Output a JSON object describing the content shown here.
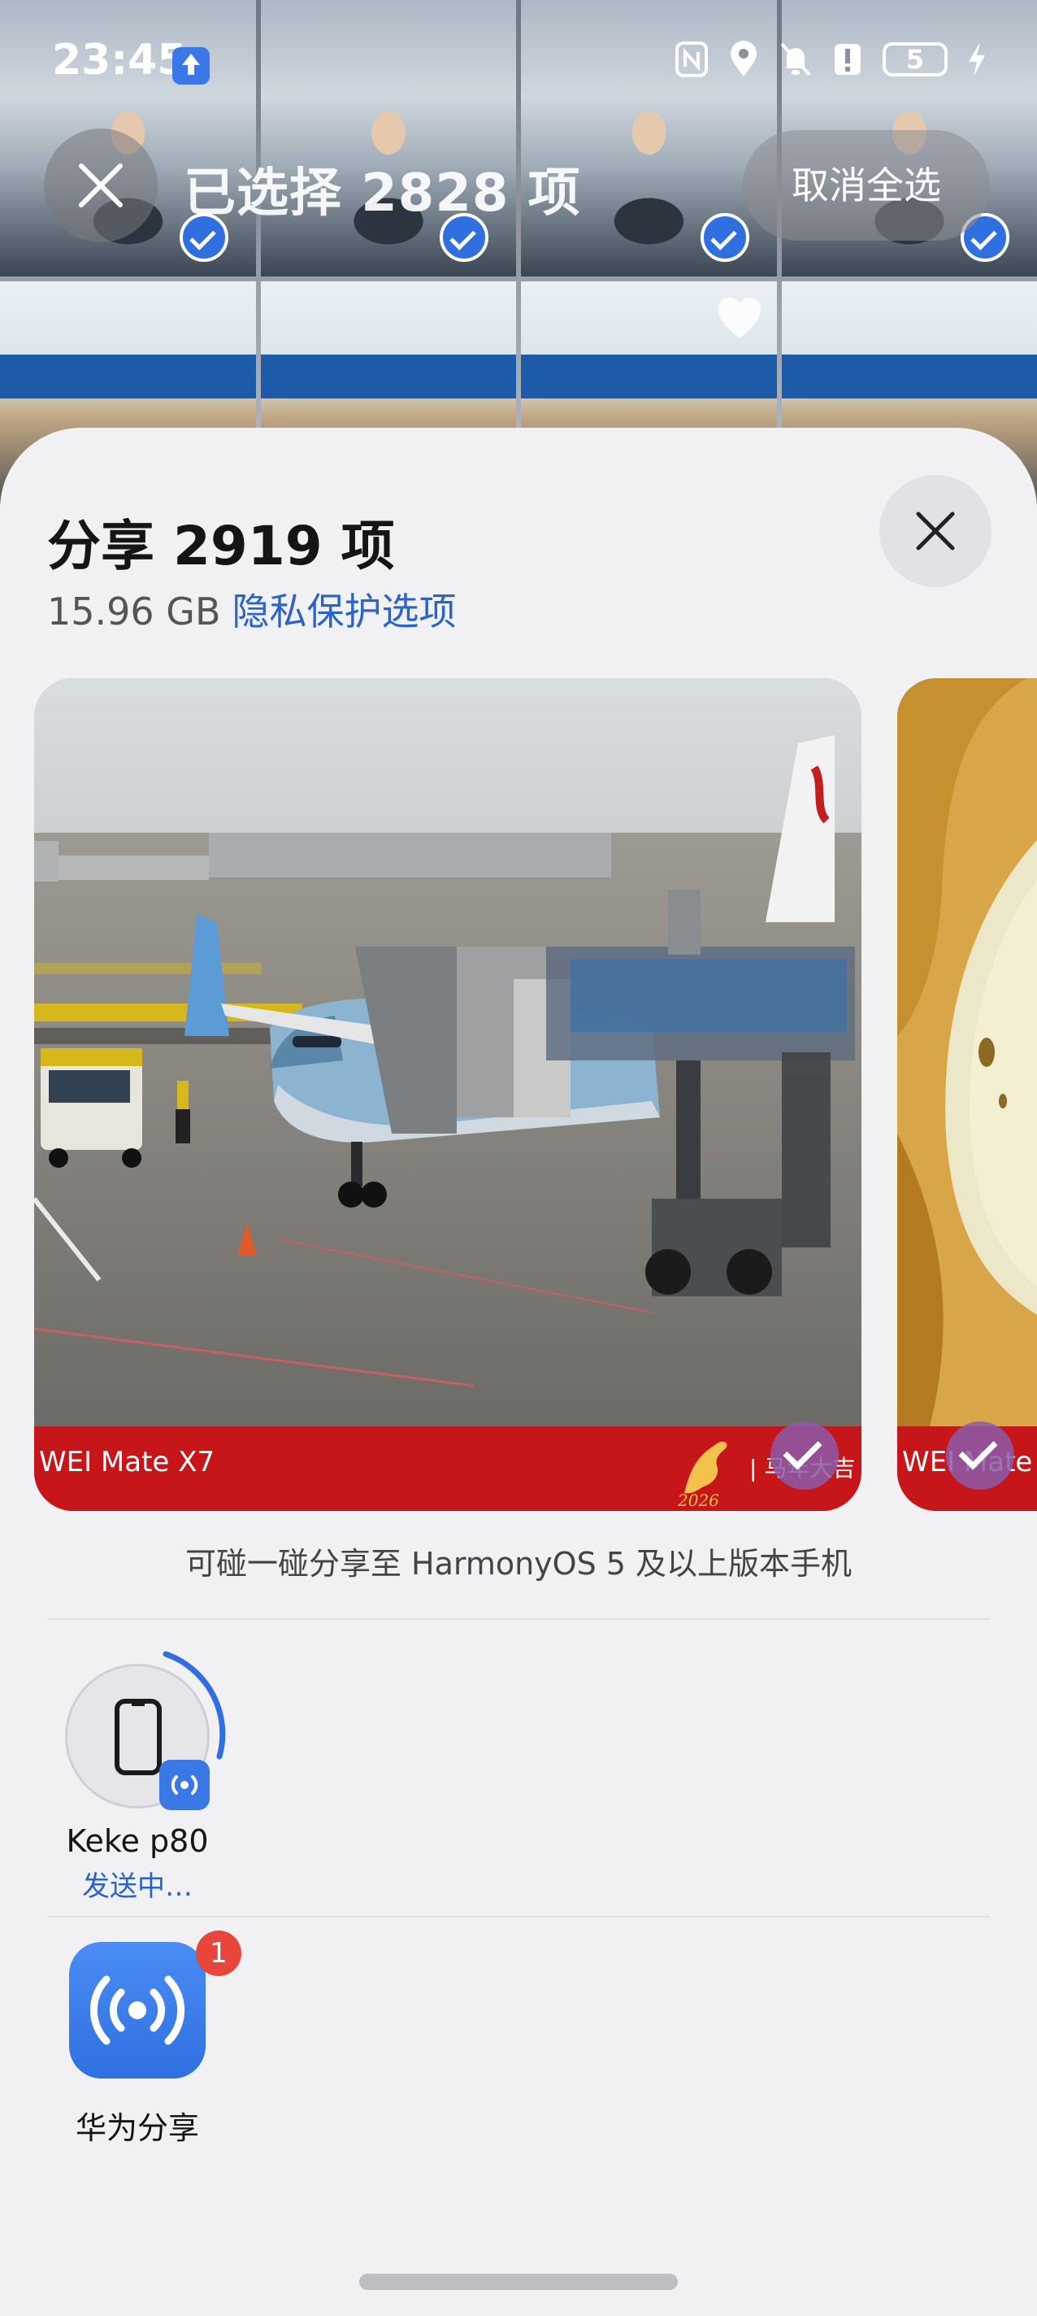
{
  "status_bar": {
    "time": "23:45",
    "battery": "5",
    "icons": [
      "nfc-icon",
      "location-icon",
      "bell-off-icon",
      "alert-icon",
      "battery-icon",
      "charging-icon"
    ]
  },
  "selection_header": {
    "title": "已选择 2828 项",
    "deselect_all_label": "取消全选"
  },
  "share_sheet": {
    "title": "分享 2919 项",
    "size": "15.96 GB",
    "privacy_link": "隐私保护选项",
    "preview_cards": [
      {
        "watermark_left": "WEI Mate X7",
        "watermark_right": "| 马年大吉  万事",
        "selected": true
      },
      {
        "watermark_left": "WEI Mate X",
        "selected": true
      }
    ],
    "nfc_hint": "可碰一碰分享至 HarmonyOS 5 及以上版本手机",
    "devices": [
      {
        "name": "Keke p80",
        "status": "发送中…",
        "icon": "phone-icon"
      }
    ],
    "apps": [
      {
        "name": "华为分享",
        "badge": "1",
        "icon": "huawei-share-icon"
      }
    ]
  },
  "colors": {
    "accent": "#2a64c8",
    "badge": "#e8463b",
    "watermark": "#c6161a",
    "sheet_bg": "#f1f1f4"
  }
}
